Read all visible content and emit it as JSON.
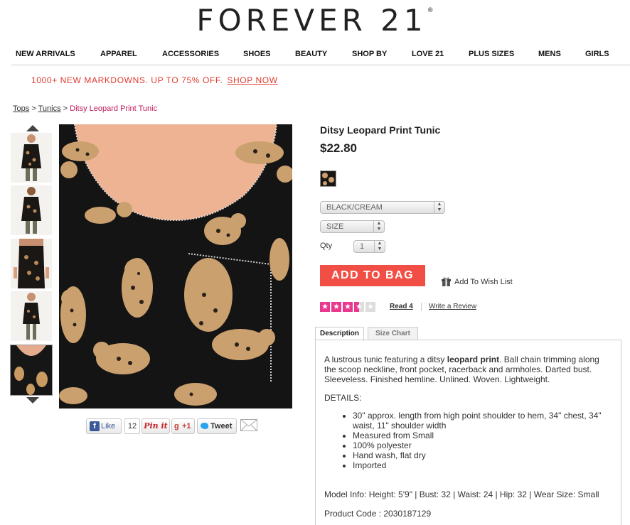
{
  "brand": {
    "name": "FOREVER 21",
    "trademark": "®"
  },
  "nav": [
    {
      "label": "NEW ARRIVALS"
    },
    {
      "label": "APPAREL"
    },
    {
      "label": "ACCESSORIES"
    },
    {
      "label": "SHOES"
    },
    {
      "label": "BEAUTY"
    },
    {
      "label": "SHOP BY"
    },
    {
      "label": "LOVE 21"
    },
    {
      "label": "PLUS SIZES"
    },
    {
      "label": "MENS"
    },
    {
      "label": "GIRLS"
    }
  ],
  "promo": {
    "text": "1000+ NEW MARKDOWNS. UP TO 75% OFF.",
    "link": "SHOP NOW",
    "color": "#e03c31"
  },
  "breadcrumb": {
    "items": [
      "Tops",
      "Tunics"
    ],
    "separator": ">",
    "current": "Ditsy Leopard Print Tunic"
  },
  "gallery": {
    "thumbnail_count": 5,
    "selected_index": 4
  },
  "social": {
    "like_label": "Like",
    "like_count": "12",
    "pinit_label": "Pin it",
    "gplus_label": "+1",
    "tweet_label": "Tweet"
  },
  "product": {
    "title": "Ditsy Leopard Print Tunic",
    "price": "$22.80",
    "color_select": "BLACK/CREAM",
    "size_select": "SIZE",
    "qty_label": "Qty",
    "qty_value": "1",
    "add_to_bag": "ADD TO BAG",
    "wish_list": "Add To Wish List",
    "rating": {
      "value": 3.5,
      "max": 5,
      "read_label": "Read 4",
      "write_label": "Write a Review",
      "color": "#e8388f"
    }
  },
  "tabs": [
    {
      "label": "Description",
      "active": true
    },
    {
      "label": "Size Chart",
      "active": false
    }
  ],
  "description": {
    "intro_before": "A lustrous tunic featuring a ditsy ",
    "intro_bold": "leopard print",
    "intro_after": ". Ball chain trimming along the scoop neckline, front pocket, racerback and armholes. Darted bust. Sleeveless. Finished hemline. Unlined. Woven. Lightweight.",
    "details_heading": "DETAILS:",
    "details": [
      "30\" approx. length from high point shoulder to hem, 34\" chest, 34\" waist, 11\" shoulder width",
      "Measured from Small",
      "100% polyester",
      "Hand wash, flat dry",
      "Imported"
    ],
    "model_info": "Model Info: Height: 5'9\" | Bust: 32 | Waist: 24 | Hip: 32 | Wear Size: Small",
    "product_code": "Product Code : 2030187129"
  }
}
